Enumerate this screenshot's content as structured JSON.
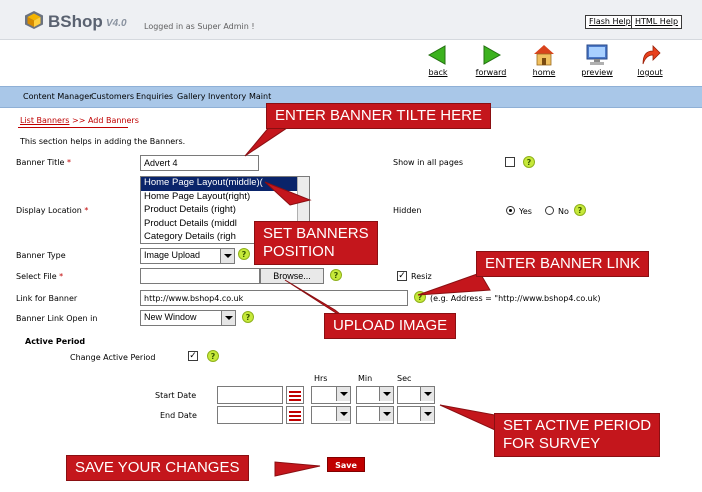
{
  "header": {
    "brand": "BShop",
    "version": "V4.0",
    "logged_in": "Logged in as Super Admin !",
    "flash_help": "Flash Help",
    "html_help": "HTML Help"
  },
  "toolbar": {
    "back": "back",
    "forward": "forward",
    "home": "home",
    "preview": "preview",
    "logout": "logout"
  },
  "nav": {
    "items": [
      "Content Manager",
      "Customers",
      "Enquiries",
      "Gallery",
      "Inventory",
      "Maint"
    ]
  },
  "breadcrumb": {
    "parent": "List Banners",
    "separator": ">>",
    "current": "Add Banners"
  },
  "intro": "This section helps in adding the Banners.",
  "form": {
    "banner_title_label": "Banner Title",
    "banner_title_value": "Advert 4",
    "show_all_pages_label": "Show in all pages",
    "display_location_label": "Display Location",
    "display_location_options": [
      "Home Page Layout(middle)(",
      "Home Page Layout(right)",
      "Product Details (right)",
      "Product Details (middl",
      "Category Details (righ"
    ],
    "hidden_label": "Hidden",
    "yes_label": "Yes",
    "no_label": "No",
    "banner_type_label": "Banner Type",
    "banner_type_value": "Image Upload",
    "select_file_label": "Select File",
    "browse_label": "Browse...",
    "resize_label": "Resiz",
    "link_label": "Link for Banner",
    "link_value": "http://www.bshop4.co.uk",
    "link_example": "(e.g. Address = \"http://www.bshop4.co.uk)",
    "open_in_label": "Banner Link Open in",
    "open_in_value": "New Window",
    "required_mark": "*",
    "hint_mark": "?"
  },
  "active_period": {
    "heading": "Active Period",
    "change_label": "Change Active Period",
    "hrs": "Hrs",
    "min": "Min",
    "sec": "Sec",
    "start_label": "Start Date",
    "end_label": "End Date"
  },
  "save_label": "Save",
  "callouts": {
    "title": "ENTER BANNER TILTE HERE",
    "position_1": "SET BANNERS",
    "position_2": "POSITION",
    "link": "ENTER BANNER LINK",
    "upload": "UPLOAD IMAGE",
    "period_1": "SET ACTIVE PERIOD",
    "period_2": "FOR SURVEY",
    "save": "SAVE YOUR CHANGES"
  },
  "colors": {
    "callout_red": "#c4161c",
    "nav_blue": "#a9c7e8",
    "selection_navy": "#0a246a"
  }
}
